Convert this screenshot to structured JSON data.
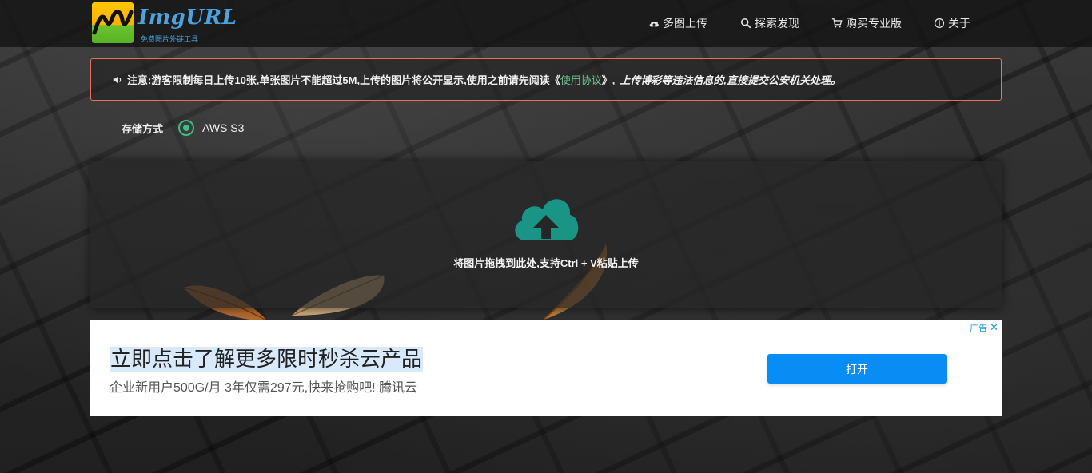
{
  "brand": {
    "name": "ImgURL",
    "subtitle": "免费图片外链工具"
  },
  "nav": {
    "items": [
      {
        "label": "多图上传",
        "icon": "cloud-upload-icon"
      },
      {
        "label": "探索发现",
        "icon": "search-icon"
      },
      {
        "label": "购买专业版",
        "icon": "cart-icon"
      },
      {
        "label": "关于",
        "icon": "info-icon"
      }
    ]
  },
  "notice": {
    "icon": "speaker-icon",
    "heading": "注意:",
    "text_before": "游客限制每日上传10张,单张图片不能超过5M,上传的图片将公开显示,使用之前请先阅读《",
    "link": "使用协议",
    "text_after": "》,",
    "warning": "上传博彩等违法信息的,直接提交公安机关处理。"
  },
  "storage": {
    "label": "存储方式",
    "option": "AWS S3",
    "selected": true
  },
  "dropzone": {
    "icon": "cloud-upload-icon",
    "text": "将图片拖拽到此处,支持Ctrl + V粘贴上传"
  },
  "ad": {
    "title": "立即点击了解更多限时秒杀云产品",
    "description": "企业新用户500G/月 3年仅需297元,快来抢购吧! 腾讯云",
    "button": "打开",
    "badge": "广告",
    "close": "✕"
  },
  "colors": {
    "accent_green": "#3dbf83",
    "cloud_teal": "#1a9484",
    "notice_border": "#e0755a",
    "link_green": "#6bc28f",
    "brand_blue": "#4aa3df",
    "ad_button": "#0a8cf5"
  }
}
